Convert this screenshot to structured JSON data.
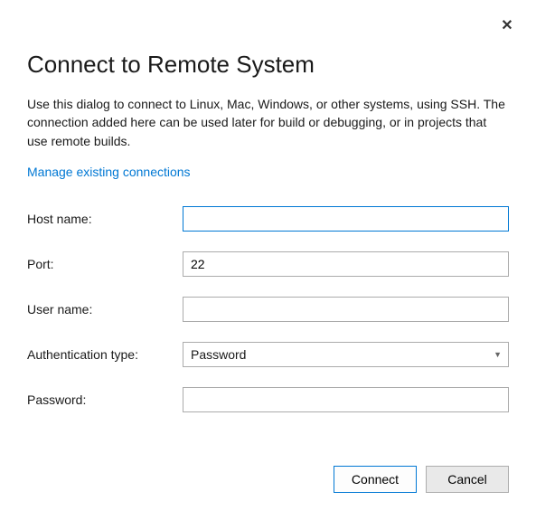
{
  "dialog": {
    "title": "Connect to Remote System",
    "description": "Use this dialog to connect to Linux, Mac, Windows, or other systems, using SSH. The connection added here can be used later for build or debugging, or in projects that use remote builds.",
    "manage_link": "Manage existing connections",
    "close_symbol": "✕"
  },
  "fields": {
    "hostname": {
      "label": "Host name:",
      "value": ""
    },
    "port": {
      "label": "Port:",
      "value": "22"
    },
    "username": {
      "label": "User name:",
      "value": ""
    },
    "authtype": {
      "label": "Authentication type:",
      "value": "Password"
    },
    "password": {
      "label": "Password:",
      "value": ""
    }
  },
  "buttons": {
    "connect": "Connect",
    "cancel": "Cancel"
  }
}
